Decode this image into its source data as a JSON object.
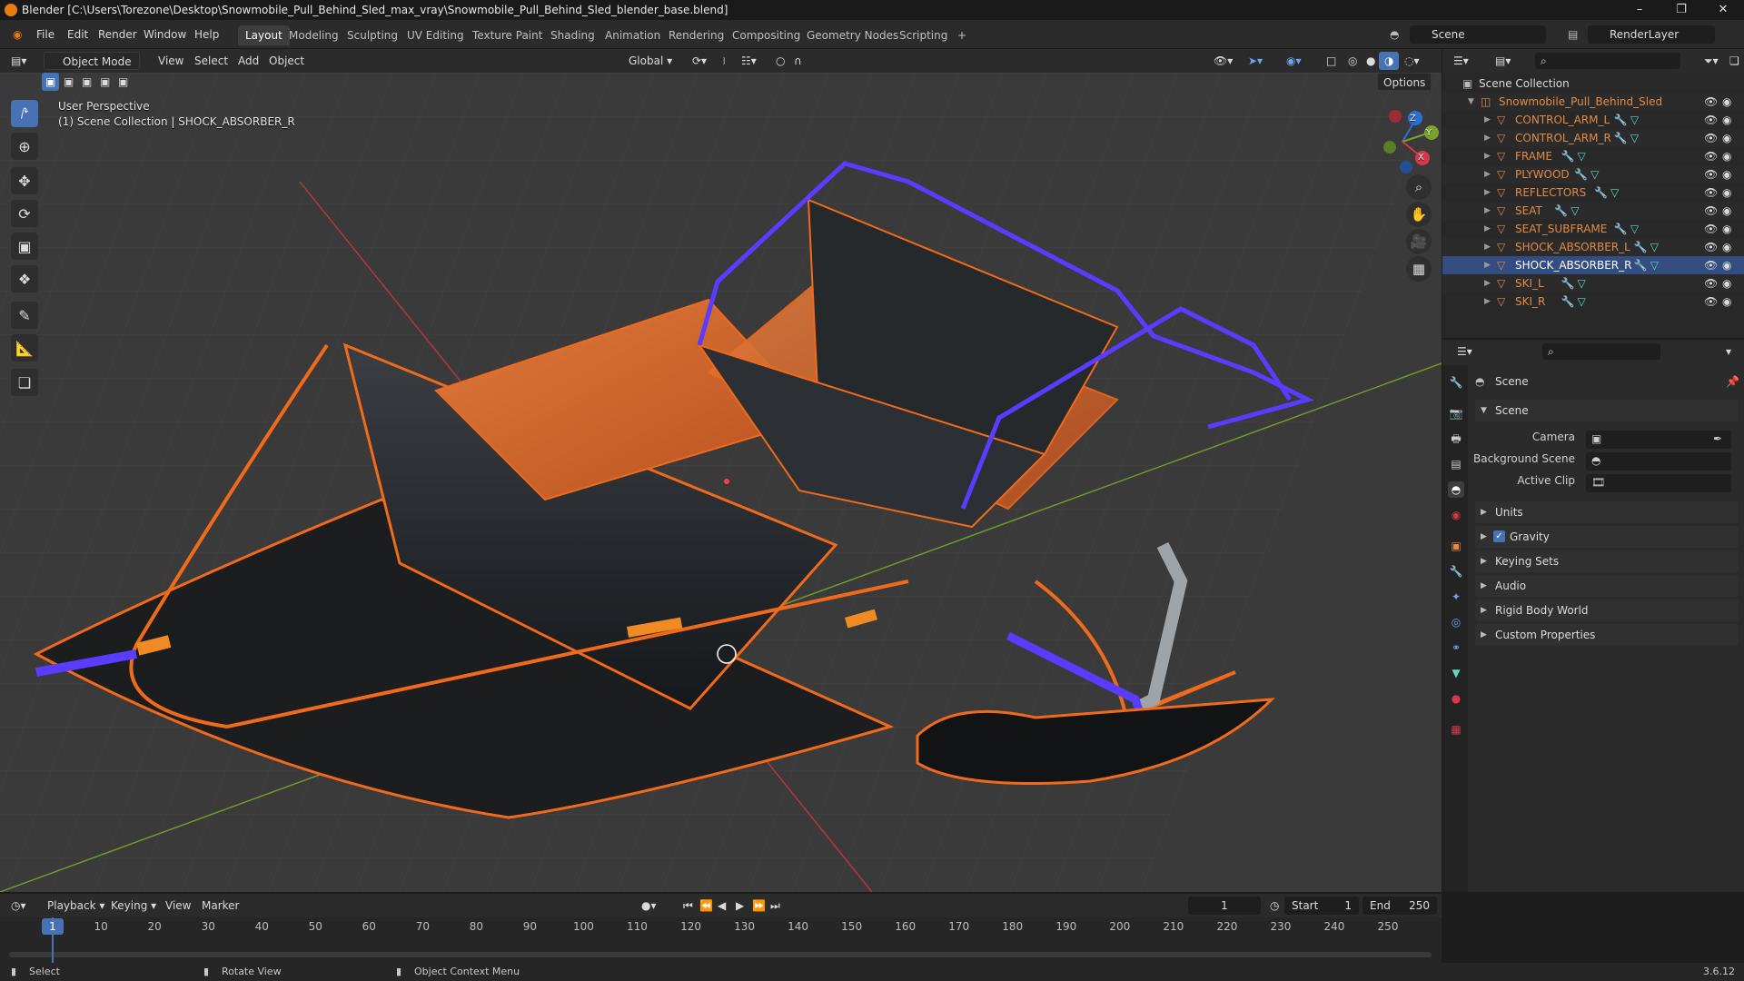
{
  "window": {
    "title": "Blender [C:\\Users\\Torezone\\Desktop\\Snowmobile_Pull_Behind_Sled_max_vray\\Snowmobile_Pull_Behind_Sled_blender_base.blend]",
    "minimize_icon": "minimize-icon",
    "maximize_icon": "maximize-icon",
    "close_icon": "close-icon"
  },
  "menubar": {
    "menus": [
      "File",
      "Edit",
      "Render",
      "Window",
      "Help"
    ],
    "workspaces": [
      "Layout",
      "Modeling",
      "Sculpting",
      "UV Editing",
      "Texture Paint",
      "Shading",
      "Animation",
      "Rendering",
      "Compositing",
      "Geometry Nodes",
      "Scripting"
    ],
    "active_workspace": "Layout",
    "add_workspace": "+",
    "scene": "Scene",
    "view_layer": "RenderLayer"
  },
  "viewport_header": {
    "mode": "Object Mode",
    "menus": [
      "View",
      "Select",
      "Add",
      "Object"
    ],
    "orientation": "Global",
    "options": "Options"
  },
  "viewport": {
    "perspective": "User Perspective",
    "context": "(1) Scene Collection | SHOCK_ABSORBER_R",
    "gizmo": {
      "z": "Z",
      "y": "Y",
      "x": "X"
    },
    "accent": "#4772b3",
    "selection_color": "#f06a1c",
    "active_color": "#5a3cff"
  },
  "toolbar": {
    "tools": [
      "select-box-icon",
      "cursor-icon",
      "move-icon",
      "rotate-icon",
      "scale-icon",
      "transform-icon",
      "annotate-icon",
      "measure-icon",
      "add-cube-icon"
    ]
  },
  "outliner": {
    "root": "Scene Collection",
    "collection": "Snowmobile_Pull_Behind_Sled",
    "objects": [
      {
        "name": "CONTROL_ARM_L",
        "selected": false
      },
      {
        "name": "CONTROL_ARM_R",
        "selected": false
      },
      {
        "name": "FRAME",
        "selected": false
      },
      {
        "name": "PLYWOOD",
        "selected": false
      },
      {
        "name": "REFLECTORS",
        "selected": false
      },
      {
        "name": "SEAT",
        "selected": false
      },
      {
        "name": "SEAT_SUBFRAME",
        "selected": false
      },
      {
        "name": "SHOCK_ABSORBER_L",
        "selected": false
      },
      {
        "name": "SHOCK_ABSORBER_R",
        "selected": true
      },
      {
        "name": "SKI_L",
        "selected": false
      },
      {
        "name": "SKI_R",
        "selected": false
      }
    ]
  },
  "properties": {
    "context": "Scene",
    "panel": "Scene",
    "camera_label": "Camera",
    "background_scene_label": "Background Scene",
    "active_clip_label": "Active Clip",
    "sections": [
      "Units",
      "Gravity",
      "Keying Sets",
      "Audio",
      "Rigid Body World",
      "Custom Properties"
    ],
    "gravity_checked": true
  },
  "timeline": {
    "menus": [
      "Playback",
      "Keying",
      "View",
      "Marker"
    ],
    "current_frame": "1",
    "start_label": "Start",
    "start": "1",
    "end_label": "End",
    "end": "250",
    "ticks": [
      "1",
      "10",
      "20",
      "30",
      "40",
      "50",
      "60",
      "70",
      "80",
      "90",
      "100",
      "110",
      "120",
      "130",
      "140",
      "150",
      "160",
      "170",
      "180",
      "190",
      "200",
      "210",
      "220",
      "230",
      "240",
      "250"
    ]
  },
  "statusbar": {
    "select": "Select",
    "rotate": "Rotate View",
    "context_menu": "Object Context Menu",
    "version": "3.6.12"
  }
}
